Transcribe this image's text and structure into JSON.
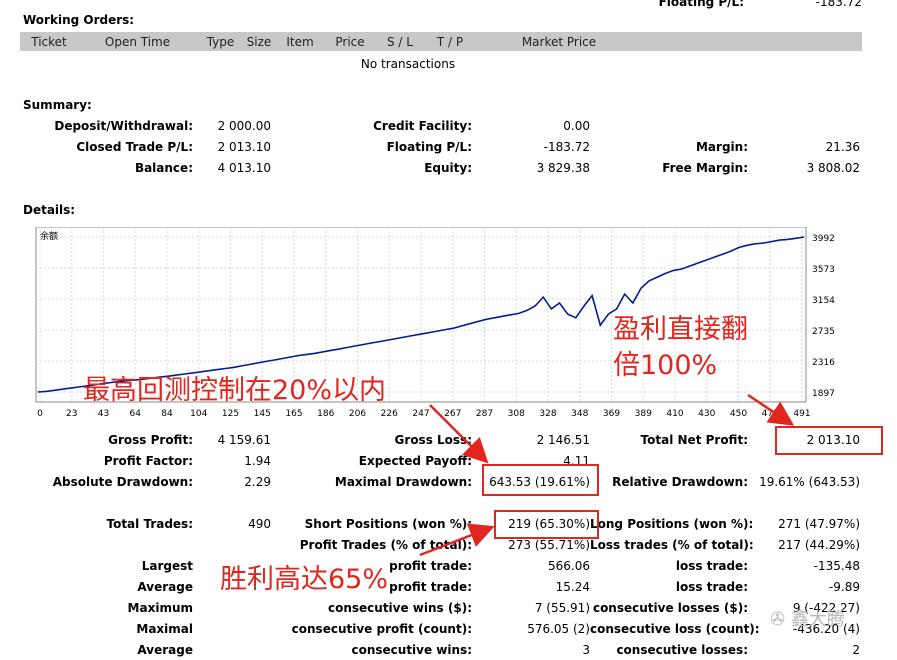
{
  "top_cut": {
    "label": "Floating P/L:",
    "value": "-183.72"
  },
  "working_orders": {
    "title": "Working Orders:",
    "columns": [
      "Ticket",
      "Open Time",
      "Type",
      "Size",
      "Item",
      "Price",
      "S / L",
      "T / P",
      "Market Price"
    ],
    "empty_text": "No transactions"
  },
  "summary": {
    "title": "Summary:",
    "rows": [
      {
        "l1": "Deposit/Withdrawal:",
        "v1": "2 000.00",
        "l2": "Credit Facility:",
        "v2": "0.00",
        "l3": "",
        "v3": ""
      },
      {
        "l1": "Closed Trade P/L:",
        "v1": "2 013.10",
        "l2": "Floating P/L:",
        "v2": "-183.72",
        "l3": "Margin:",
        "v3": "21.36"
      },
      {
        "l1": "Balance:",
        "v1": "4 013.10",
        "l2": "Equity:",
        "v2": "3 829.38",
        "l3": "Free Margin:",
        "v3": "3 808.02"
      }
    ]
  },
  "details": {
    "title": "Details:"
  },
  "chart_data": {
    "type": "line",
    "series": [
      {
        "name": "余额",
        "values": [
          1897,
          1905,
          1920,
          1935,
          1950,
          1965,
          1980,
          1995,
          2010,
          2025,
          2040,
          2050,
          2060,
          2072,
          2085,
          2098,
          2110,
          2125,
          2140,
          2155,
          2170,
          2185,
          2200,
          2215,
          2230,
          2250,
          2270,
          2290,
          2310,
          2330,
          2350,
          2370,
          2390,
          2405,
          2420,
          2440,
          2460,
          2480,
          2500,
          2520,
          2540,
          2560,
          2580,
          2600,
          2620,
          2640,
          2660,
          2680,
          2700,
          2720,
          2740,
          2760,
          2790,
          2820,
          2850,
          2880,
          2900,
          2920,
          2940,
          2960,
          3000,
          3060,
          3180,
          3020,
          3100,
          2950,
          2900,
          3060,
          3200,
          2800,
          2950,
          3020,
          3220,
          3100,
          3300,
          3400,
          3450,
          3500,
          3540,
          3560,
          3600,
          3640,
          3680,
          3720,
          3760,
          3800,
          3850,
          3880,
          3900,
          3910,
          3930,
          3950,
          3960,
          3975,
          3992
        ]
      }
    ],
    "x_ticks": [
      "0",
      "23",
      "43",
      "64",
      "84",
      "104",
      "125",
      "145",
      "165",
      "186",
      "206",
      "226",
      "247",
      "267",
      "287",
      "308",
      "328",
      "348",
      "369",
      "389",
      "410",
      "430",
      "450",
      "471",
      "491"
    ],
    "y_ticks": [
      "3992",
      "3573",
      "3154",
      "2735",
      "2316",
      "1897"
    ],
    "xlim": [
      0,
      500
    ],
    "ylim": [
      1897,
      3992
    ]
  },
  "stats": {
    "rows1": [
      {
        "l1": "Gross Profit:",
        "v1": "4 159.61",
        "l2": "Gross Loss:",
        "v2": "2 146.51",
        "l3": "Total Net Profit:",
        "v3": "2 013.10"
      },
      {
        "l1": "Profit Factor:",
        "v1": "1.94",
        "l2": "Expected Payoff:",
        "v2": "4.11",
        "l3": "",
        "v3": ""
      },
      {
        "l1": "Absolute Drawdown:",
        "v1": "2.29",
        "l2": "Maximal Drawdown:",
        "v2": "643.53 (19.61%)",
        "l3": "Relative Drawdown:",
        "v3": "19.61% (643.53)"
      }
    ],
    "total_trades": {
      "label": "Total Trades:",
      "value": "490"
    },
    "rows2": [
      {
        "l1": "",
        "v1": "",
        "l2": "Short Positions (won %):",
        "v2": "219 (65.30%)",
        "l3": "Long Positions (won %):",
        "v3": "271 (47.97%)"
      },
      {
        "l1": "",
        "v1": "",
        "l2": "Profit Trades (% of total):",
        "v2": "273 (55.71%)",
        "l3": "Loss trades (% of total):",
        "v3": "217 (44.29%)"
      },
      {
        "l1": "Largest",
        "v1": "",
        "l2": "profit trade:",
        "v2": "566.06",
        "l3": "loss trade:",
        "v3": "-135.48"
      },
      {
        "l1": "Average",
        "v1": "",
        "l2": "profit trade:",
        "v2": "15.24",
        "l3": "loss trade:",
        "v3": "-9.89"
      },
      {
        "l1": "Maximum",
        "v1": "",
        "l2": "consecutive wins ($):",
        "v2": "7 (55.91)",
        "l3": "consecutive losses ($):",
        "v3": "9 (-422.27)"
      },
      {
        "l1": "Maximal",
        "v1": "",
        "l2": "consecutive profit (count):",
        "v2": "576.05 (2)",
        "l3": "consecutive loss (count):",
        "v3": "-436.20 (4)"
      },
      {
        "l1": "Average",
        "v1": "",
        "l2": "consecutive wins:",
        "v2": "3",
        "l3": "consecutive losses:",
        "v3": "2"
      }
    ]
  },
  "annotations": {
    "profit_double": [
      "盈利直接翻",
      "倍100%"
    ],
    "drawdown": "最高回测控制在20%以内",
    "winrate": "胜利高达65%",
    "color": "#e0261e"
  },
  "watermark": "鑫大腾"
}
